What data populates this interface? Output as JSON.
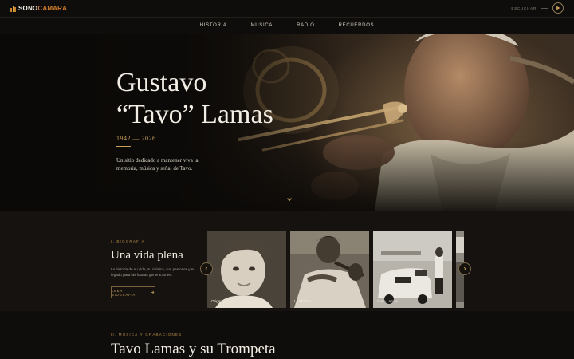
{
  "brand": {
    "name_a": "SONO",
    "name_b": "CAMARA"
  },
  "player": {
    "label": "ESCUCHAR"
  },
  "nav": {
    "items": [
      "HISTORIA",
      "MÚSICA",
      "RADIO",
      "RECUERDOS"
    ]
  },
  "hero": {
    "title_line1": "Gustavo",
    "title_line2": "“Tavo” Lamas",
    "dates": "1942 — 2026",
    "description": "Un sitio dedicado a mantener viva la memoria, música y señal de Tavo."
  },
  "bio": {
    "kicker": "I. BIOGRAFÍA",
    "title": "Una vida plena",
    "text": "La historia de su vida, su música, sus pasiones y su legado para las futuras generaciones.",
    "button_label": "LEER BIOGRAFÍA",
    "cards": [
      {
        "caption": "Origen"
      },
      {
        "caption": "La Música"
      },
      {
        "caption": "Casa Lamas"
      }
    ]
  },
  "music": {
    "kicker": "II. MÚSICA Y GRABACIONES",
    "title": "Tavo Lamas y su Trompeta"
  },
  "colors": {
    "accent": "#c9a15b",
    "brand_orange": "#d07a2a",
    "background": "#0e0c0a"
  },
  "icons": [
    "play-icon",
    "chevron-down-icon",
    "chevron-left-icon",
    "chevron-right-icon",
    "arrow-right-icon"
  ]
}
